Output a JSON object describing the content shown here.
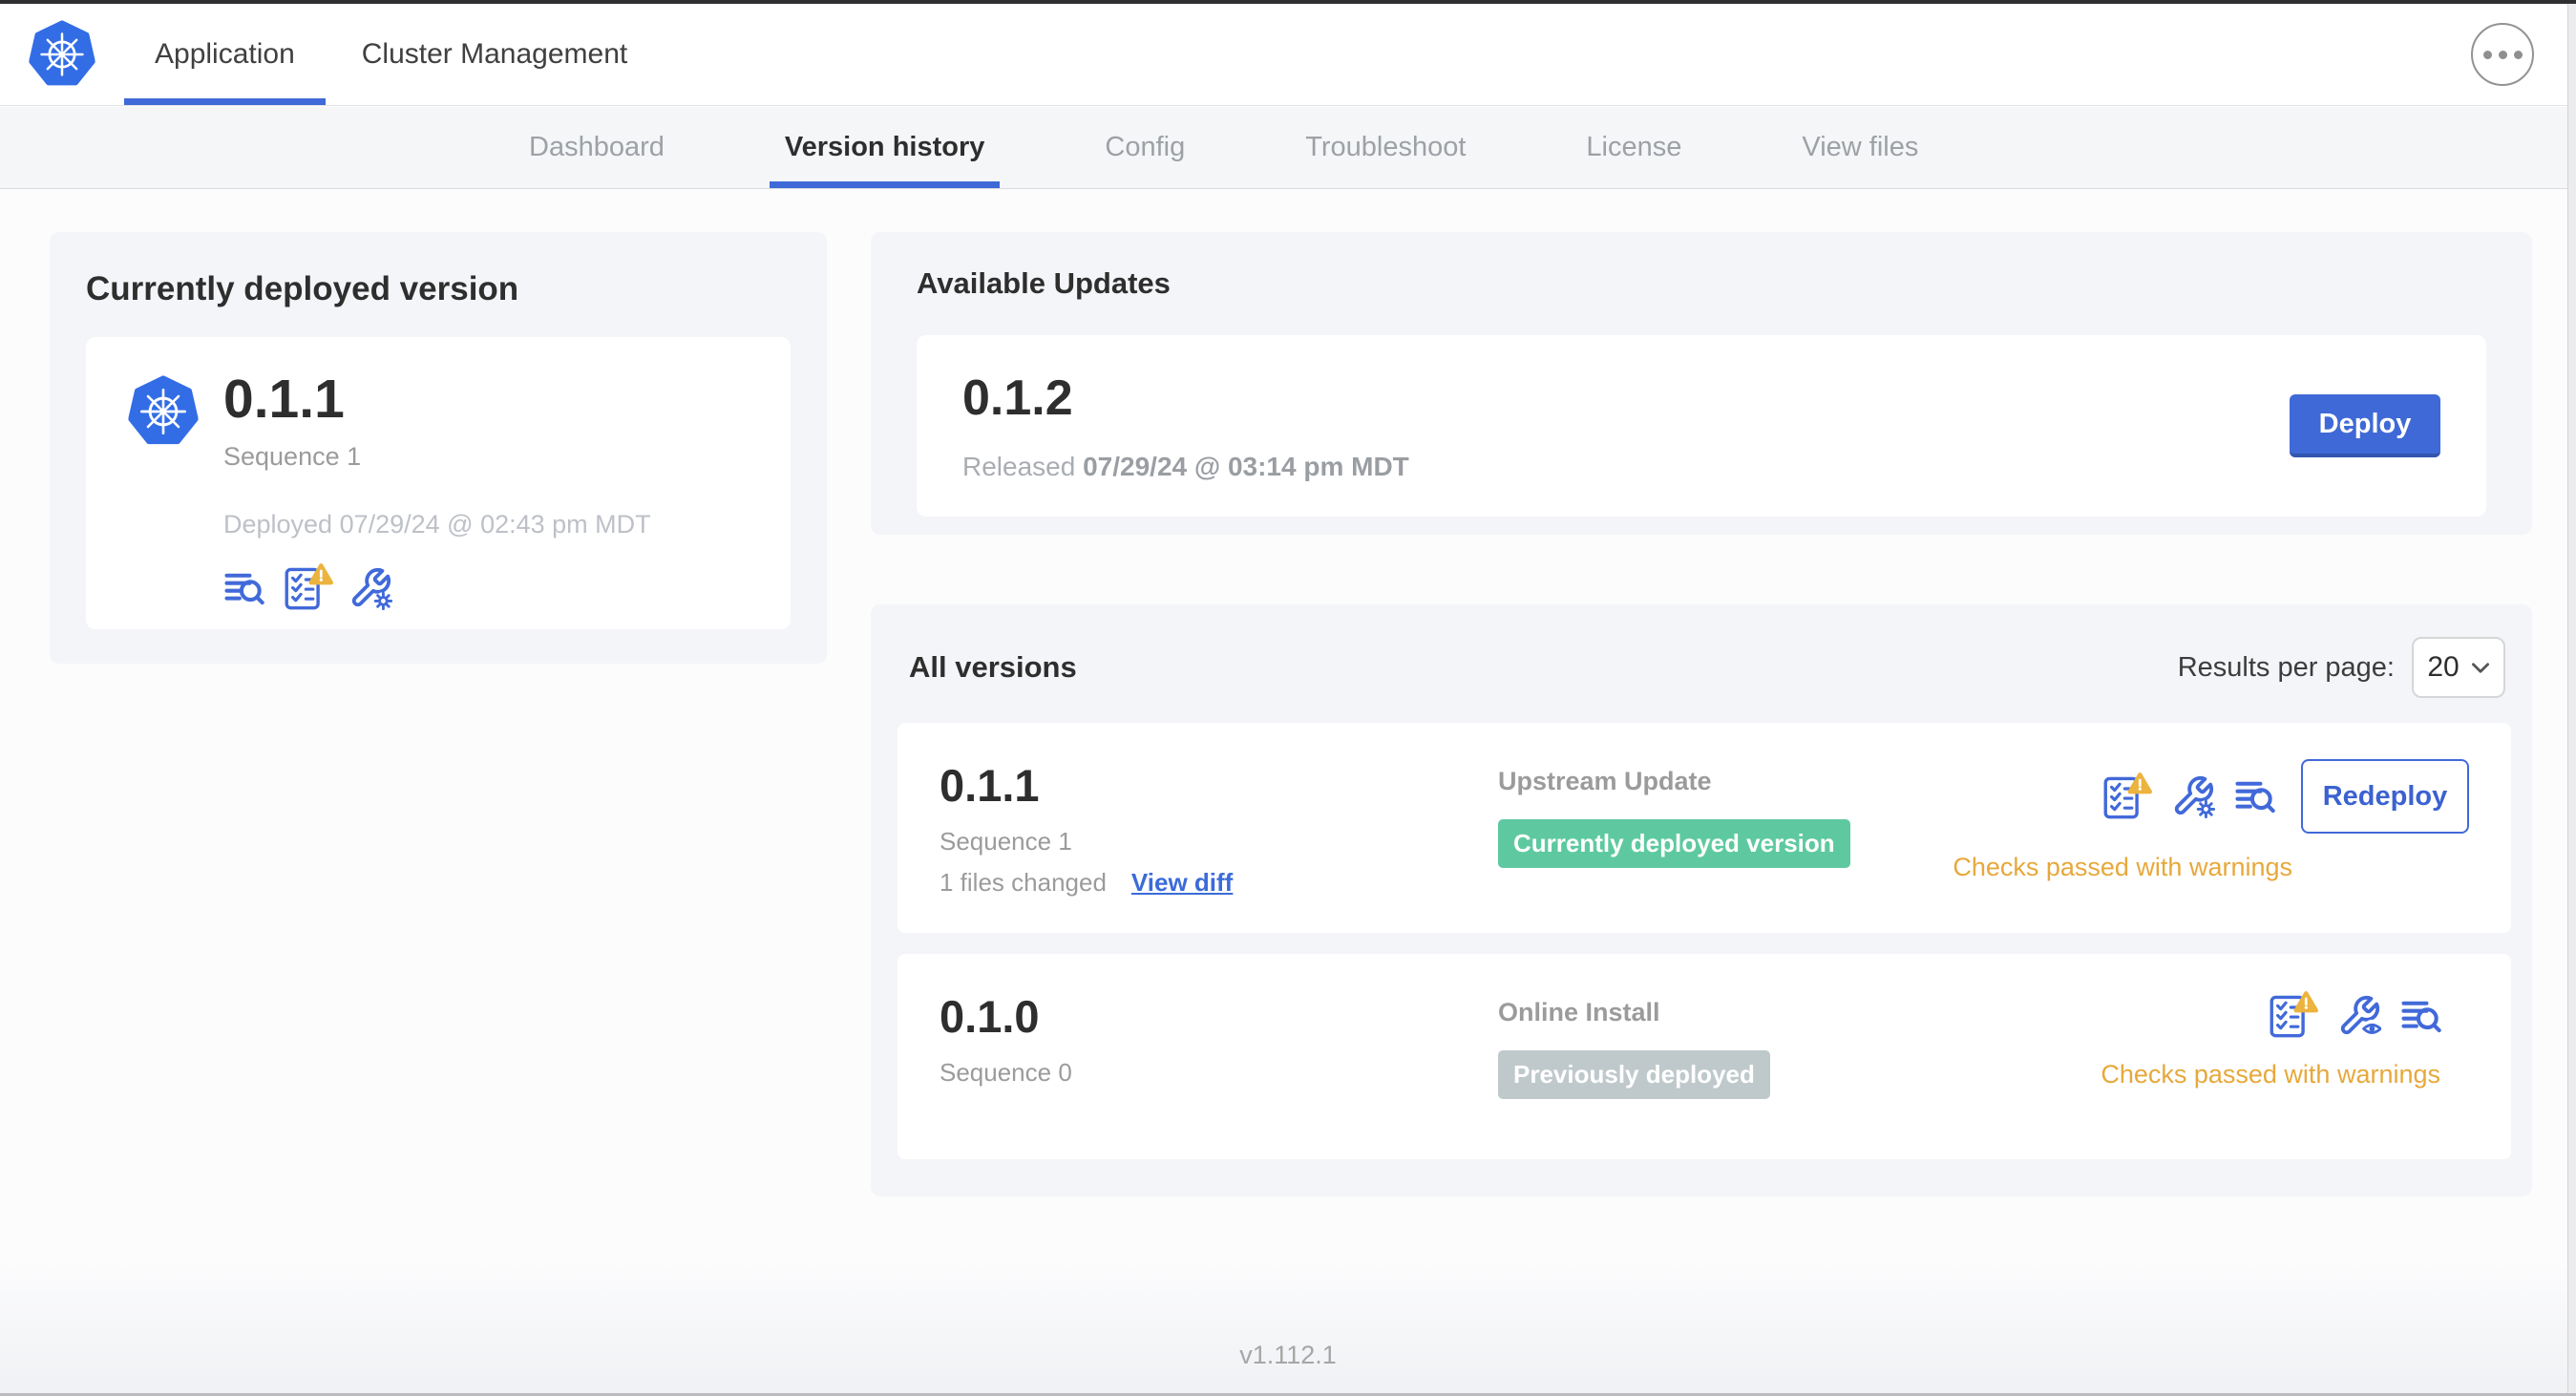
{
  "colors": {
    "accent_blue": "#3f69d6",
    "icon_blue": "#4169d9",
    "success_green": "#5ec9a0",
    "muted_badge_gray": "#bfc9cb",
    "warning_amber": "#e7a83b"
  },
  "header": {
    "logo": "kubernetes-logo",
    "tabs": [
      {
        "label": "Application",
        "active": true
      },
      {
        "label": "Cluster Management",
        "active": false
      }
    ],
    "menu_icon": "ellipsis-icon"
  },
  "subnav": {
    "items": [
      {
        "label": "Dashboard",
        "active": false
      },
      {
        "label": "Version history",
        "active": true
      },
      {
        "label": "Config",
        "active": false
      },
      {
        "label": "Troubleshoot",
        "active": false
      },
      {
        "label": "License",
        "active": false
      },
      {
        "label": "View files",
        "active": false
      }
    ]
  },
  "current_version_card": {
    "title": "Currently deployed version",
    "version": "0.1.1",
    "sequence": "Sequence 1",
    "deployed": "Deployed 07/29/24 @ 02:43 pm MDT",
    "icons": [
      "diff-logs-icon",
      "preflight-checks-warning-icon",
      "config-edit-icon"
    ]
  },
  "available_updates": {
    "title": "Available Updates",
    "version": "0.1.2",
    "released_label": "Released",
    "released_date": "07/29/24 @ 03:14 pm MDT",
    "deploy_button": "Deploy"
  },
  "all_versions": {
    "title": "All versions",
    "results_per_page_label": "Results per page:",
    "results_per_page_value": "20",
    "rows": [
      {
        "version": "0.1.1",
        "sequence": "Sequence 1",
        "files_changed": "1 files changed",
        "view_diff_label": "View diff",
        "source": "Upstream Update",
        "badge_label": "Currently deployed version",
        "badge_style": "green",
        "status": "Checks passed with warnings",
        "action_button": "Redeploy",
        "icons": [
          "preflight-checks-warning-icon",
          "config-edit-icon",
          "diff-logs-icon"
        ]
      },
      {
        "version": "0.1.0",
        "sequence": "Sequence 0",
        "source": "Online Install",
        "badge_label": "Previously deployed",
        "badge_style": "gray",
        "status": "Checks passed with warnings",
        "icons": [
          "preflight-checks-warning-icon",
          "config-view-icon",
          "diff-logs-icon"
        ]
      }
    ]
  },
  "footer": {
    "version": "v1.112.1"
  }
}
